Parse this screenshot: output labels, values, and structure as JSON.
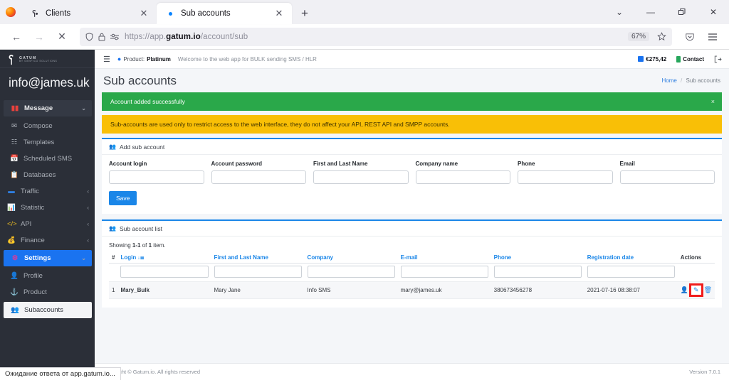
{
  "browser": {
    "tabs": [
      {
        "title": "Clients",
        "active": false,
        "favicon": "gatum-logo-icon"
      },
      {
        "title": "Sub accounts",
        "active": true,
        "favicon": "loading-dot-icon"
      }
    ],
    "new_tab_label": "+",
    "window_controls": {
      "list_all_tabs": "⌄",
      "minimize": "—",
      "maximize": "❐",
      "close": "✕"
    },
    "nav": {
      "back": "←",
      "forward": "→",
      "stop": "✕"
    },
    "url": {
      "scheme": "https://app.",
      "domain": "gatum.io",
      "path": "/account/sub"
    },
    "zoom_level": "67%",
    "bookmark_icon": "star-icon",
    "pocket_icon": "pocket-icon",
    "menu_icon": "hamburger-menu-icon"
  },
  "status_bar": {
    "text": "Ожидание ответа от app.gatum.io..."
  },
  "sidebar": {
    "brand": {
      "name": "GATUM",
      "tagline": "BY GENFICO SOLUTIONS"
    },
    "user_email": "info@james.uk",
    "items": [
      {
        "label": "Message",
        "icon": "message-icon",
        "icon_color": "#e8413c",
        "state": "group",
        "caret": "⌄"
      },
      {
        "label": "Compose",
        "icon": "envelope-icon",
        "icon_color": "#c9ced6",
        "state": "sub",
        "caret": ""
      },
      {
        "label": "Templates",
        "icon": "template-icon",
        "icon_color": "#c9ced6",
        "state": "sub",
        "caret": ""
      },
      {
        "label": "Scheduled SMS",
        "icon": "calendar-icon",
        "icon_color": "#c9ced6",
        "state": "sub",
        "caret": ""
      },
      {
        "label": "Databases",
        "icon": "database-icon",
        "icon_color": "#c9ced6",
        "state": "sub",
        "caret": ""
      },
      {
        "label": "Traffic",
        "icon": "traffic-icon",
        "icon_color": "#2f7fe0",
        "state": "normal",
        "caret": "‹"
      },
      {
        "label": "Statistic",
        "icon": "chart-icon",
        "icon_color": "#2faa5a",
        "state": "normal",
        "caret": "‹"
      },
      {
        "label": "API",
        "icon": "code-icon",
        "icon_color": "#e8b923",
        "state": "normal",
        "caret": "‹"
      },
      {
        "label": "Finance",
        "icon": "finance-icon",
        "icon_color": "#2fb0a0",
        "state": "normal",
        "caret": "‹"
      },
      {
        "label": "Settings",
        "icon": "settings-icon",
        "icon_color": "#e0399a",
        "state": "active-blue",
        "caret": "⌄"
      },
      {
        "label": "Profile",
        "icon": "user-icon",
        "icon_color": "#c9ced6",
        "state": "sub",
        "caret": ""
      },
      {
        "label": "Product",
        "icon": "product-icon",
        "icon_color": "#c9ced6",
        "state": "sub",
        "caret": ""
      },
      {
        "label": "Subaccounts",
        "icon": "subaccounts-icon",
        "icon_color": "#2b2f38",
        "state": "selected-light",
        "caret": ""
      }
    ]
  },
  "topbar": {
    "hamburger": "☰",
    "product_label": "Product:",
    "product_value": "Platinum",
    "welcome": "Welcome to the web app for BULK sending SMS / HLR",
    "balance": "€275,42",
    "contact": "Contact",
    "logout_icon": "logout-icon"
  },
  "page": {
    "title": "Sub accounts",
    "breadcrumb": {
      "home": "Home",
      "separator": "/",
      "current": "Sub accounts"
    }
  },
  "alerts": [
    {
      "type": "success",
      "text": "Account added successfully",
      "close": "×"
    },
    {
      "type": "warning",
      "text": "Sub-accounts are used only to restrict access to the web interface, they do not affect your API, REST API and SMPP accounts."
    }
  ],
  "add_form": {
    "card_title": "Add sub account",
    "card_icon": "subaccounts-icon",
    "fields": [
      {
        "label": "Account login",
        "value": "",
        "placeholder": "",
        "name": "account-login-input"
      },
      {
        "label": "Account password",
        "value": "",
        "placeholder": "",
        "name": "account-password-input"
      },
      {
        "label": "First and Last Name",
        "value": "",
        "placeholder": "",
        "name": "first-last-name-input"
      },
      {
        "label": "Company name",
        "value": "",
        "placeholder": "",
        "name": "company-name-input"
      },
      {
        "label": "Phone",
        "value": "",
        "placeholder": "",
        "name": "phone-input"
      },
      {
        "label": "Email",
        "value": "",
        "placeholder": "",
        "name": "email-input"
      }
    ],
    "save_label": "Save"
  },
  "list": {
    "card_title": "Sub account list",
    "card_icon": "subaccounts-icon",
    "showing_prefix": "Showing ",
    "showing_range": "1-1",
    "showing_mid": " of ",
    "showing_total": "1",
    "showing_suffix": " item.",
    "columns": [
      {
        "key": "num",
        "label": "#",
        "sortable": false,
        "sort_icon": ""
      },
      {
        "key": "login",
        "label": "Login",
        "sortable": true,
        "sort_icon": "sort-desc-icon"
      },
      {
        "key": "name",
        "label": "First and Last Name",
        "sortable": true,
        "sort_icon": ""
      },
      {
        "key": "company",
        "label": "Company",
        "sortable": true,
        "sort_icon": ""
      },
      {
        "key": "email",
        "label": "E-mail",
        "sortable": true,
        "sort_icon": ""
      },
      {
        "key": "phone",
        "label": "Phone",
        "sortable": true,
        "sort_icon": ""
      },
      {
        "key": "regdate",
        "label": "Registration date",
        "sortable": true,
        "sort_icon": ""
      },
      {
        "key": "actions",
        "label": "Actions",
        "sortable": false,
        "sort_icon": ""
      }
    ],
    "filters": {
      "login": "",
      "name": "",
      "company": "",
      "email": "",
      "phone": "",
      "regdate": ""
    },
    "rows": [
      {
        "num": "1",
        "login": "Mary_Bulk",
        "name": "Mary Jane",
        "company": "Info SMS",
        "email": "mary@james.uk",
        "phone": "380673456278",
        "regdate": "2021-07-16 08:38:07",
        "actions": [
          {
            "icon": "login-as-user-icon",
            "highlighted": false
          },
          {
            "icon": "edit-icon",
            "highlighted": true
          },
          {
            "icon": "delete-icon",
            "highlighted": false
          }
        ]
      }
    ]
  },
  "footer": {
    "copyright": "Copyright © Gatum.io. All rights reserved",
    "version": "Version 7.0.1"
  },
  "colors": {
    "accent_blue": "#1a86e8",
    "sidebar_bg": "#2b2f38",
    "active_nav": "#1a73f0",
    "success": "#2aa84a",
    "warning": "#f9bf06",
    "highlight_red": "#f01c1c"
  }
}
